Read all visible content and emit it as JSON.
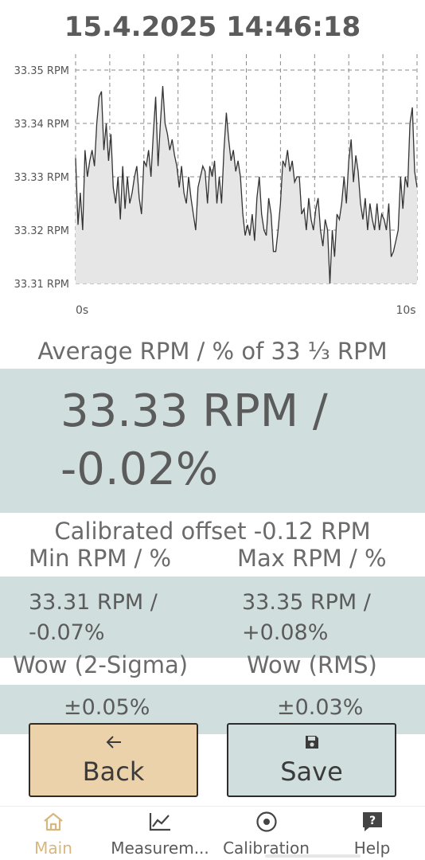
{
  "header": {
    "timestamp": "15.4.2025 14:46:18"
  },
  "chart_data": {
    "type": "area",
    "title": "",
    "xlabel": "",
    "ylabel": "",
    "xlim": [
      0,
      10
    ],
    "ylim": [
      33.31,
      33.35
    ],
    "y_ticks": [
      "33.35 RPM",
      "33.34 RPM",
      "33.33 RPM",
      "33.32 RPM",
      "33.31 RPM"
    ],
    "y_tick_values": [
      33.35,
      33.34,
      33.33,
      33.32,
      33.31
    ],
    "x_ticks": [
      "0s",
      "10s"
    ],
    "x_tick_values": [
      0,
      10
    ],
    "grid": true,
    "colors": {
      "line": "#333333",
      "fill": "#e6e6e6",
      "grid": "#8a8a8a"
    },
    "series": [
      {
        "values": [
          33.3335,
          33.321,
          33.327,
          33.32,
          33.335,
          33.33,
          33.333,
          33.335,
          33.332,
          33.34,
          33.345,
          33.346,
          33.335,
          33.34,
          33.333,
          33.338,
          33.328,
          33.325,
          33.33,
          33.322,
          33.332,
          33.324,
          33.33,
          33.325,
          33.327,
          33.33,
          33.332,
          33.326,
          33.323,
          33.333,
          33.332,
          33.335,
          33.33,
          33.338,
          33.345,
          33.332,
          33.34,
          33.347,
          33.34,
          33.338,
          33.335,
          33.337,
          33.334,
          33.332,
          33.328,
          33.332,
          33.327,
          33.325,
          33.33,
          33.326,
          33.323,
          33.32,
          33.328,
          33.33,
          33.332,
          33.331,
          33.325,
          33.332,
          33.33,
          33.333,
          33.325,
          33.33,
          33.325,
          33.335,
          33.342,
          33.337,
          33.333,
          33.335,
          33.331,
          33.333,
          33.33,
          33.323,
          33.319,
          33.321,
          33.319,
          33.323,
          33.318,
          33.326,
          33.33,
          33.323,
          33.32,
          33.319,
          33.326,
          33.323,
          33.316,
          33.316,
          33.32,
          33.325,
          33.333,
          33.332,
          33.335,
          33.331,
          33.333,
          33.329,
          33.33,
          33.33,
          33.323,
          33.324,
          33.32,
          33.326,
          33.322,
          33.32,
          33.324,
          33.326,
          33.32,
          33.317,
          33.322,
          33.32,
          33.31,
          33.32,
          33.315,
          33.323,
          33.322,
          33.325,
          33.33,
          33.325,
          33.333,
          33.337,
          33.329,
          33.334,
          33.331,
          33.325,
          33.322,
          33.326,
          33.32,
          33.325,
          33.322,
          33.32,
          33.325,
          33.32,
          33.323,
          33.322,
          33.32,
          33.325,
          33.315,
          33.316,
          33.318,
          33.32,
          33.33,
          33.324,
          33.33,
          33.328,
          33.34,
          33.343,
          33.331,
          33.328
        ]
      }
    ]
  },
  "average": {
    "label": "Average RPM / % of 33 ⅓ RPM",
    "value_line1": "33.33 RPM /",
    "value_line2": "-0.02%"
  },
  "calibration": {
    "text": "Calibrated offset  -0.12 RPM"
  },
  "minmax": {
    "min_label": "Min RPM / %",
    "max_label": "Max RPM / %",
    "min_rpm": "33.31 RPM /",
    "min_pct": "-0.07%",
    "max_rpm": "33.35 RPM /",
    "max_pct": "+0.08%"
  },
  "wow": {
    "sigma_label": "Wow (2-Sigma)",
    "rms_label": "Wow (RMS)",
    "sigma_value": "±0.05%",
    "rms_value": "±0.03%"
  },
  "buttons": {
    "back_label": "Back",
    "back_icon": "arrow-left-icon",
    "save_label": "Save",
    "save_icon": "floppy-disk-icon",
    "colors": {
      "back": "#ecd2aa",
      "save": "#d0dfde"
    }
  },
  "nav": {
    "items": [
      {
        "label": "Main",
        "icon": "home-icon",
        "active": true
      },
      {
        "label": "Measurem...",
        "icon": "chart-line-icon",
        "active": false
      },
      {
        "label": "Calibration",
        "icon": "target-icon",
        "active": false
      },
      {
        "label": "Help",
        "icon": "help-icon",
        "active": false
      }
    ],
    "active_color": "#d8b77e"
  },
  "colors": {
    "panel": "#d0dfde",
    "text": "#5f5f5f"
  }
}
